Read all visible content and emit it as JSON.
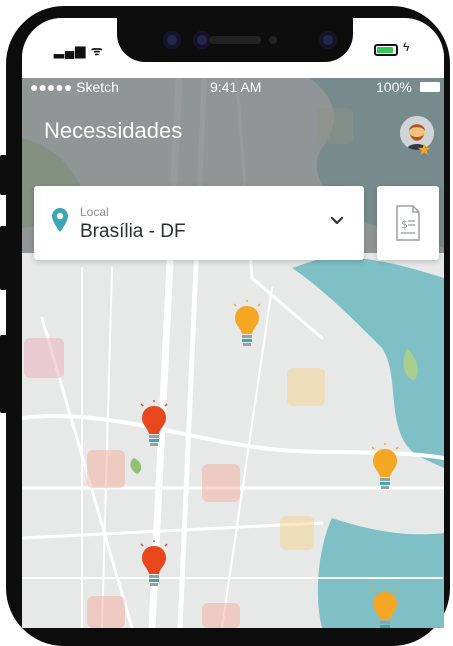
{
  "device_status": {
    "battery_level": 0.9,
    "battery_color": "#34c759"
  },
  "status_bar": {
    "carrier": "●●●●● Sketch",
    "time": "9:41 AM",
    "battery": "100%"
  },
  "header": {
    "title": "Necessidades",
    "avatar_icon": "user-avatar",
    "badge_icon": "star-icon"
  },
  "location_selector": {
    "label": "Local",
    "value": "Brasília - DF",
    "icon": "map-pin-icon",
    "dropdown_icon": "chevron-down-icon"
  },
  "document_button": {
    "icon": "invoice-document-icon"
  },
  "map": {
    "markers": [
      {
        "icon": "lightbulb-icon",
        "status": "pending",
        "color": "#f5a623"
      },
      {
        "icon": "lightbulb-icon",
        "status": "urgent",
        "color": "#e8471d"
      },
      {
        "icon": "lightbulb-icon",
        "status": "pending",
        "color": "#f5a623"
      },
      {
        "icon": "lightbulb-icon",
        "status": "urgent",
        "color": "#e8471d"
      },
      {
        "icon": "lightbulb-icon",
        "status": "pending",
        "color": "#f5a623"
      }
    ],
    "colors": {
      "water": "#7fc0c6",
      "land": "#e7e9e8",
      "park": "#b9d8a0",
      "overlay": "#6f7574"
    }
  }
}
